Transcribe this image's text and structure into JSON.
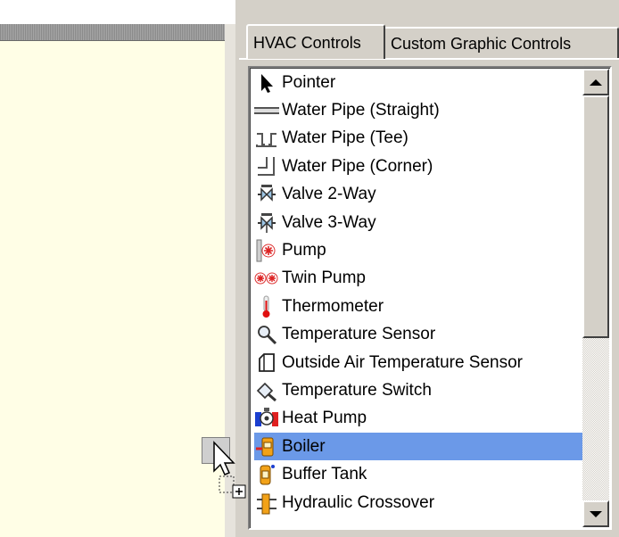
{
  "tabs": [
    {
      "label": "HVAC Controls",
      "active": true
    },
    {
      "label": "Custom Graphic Controls",
      "active": false
    }
  ],
  "list": {
    "selected_index": 13,
    "items": [
      {
        "label": "Pointer",
        "icon": "pointer-icon"
      },
      {
        "label": "Water Pipe (Straight)",
        "icon": "pipe-straight-icon"
      },
      {
        "label": "Water Pipe (Tee)",
        "icon": "pipe-tee-icon"
      },
      {
        "label": "Water Pipe (Corner)",
        "icon": "pipe-corner-icon"
      },
      {
        "label": "Valve 2-Way",
        "icon": "valve-2way-icon"
      },
      {
        "label": "Valve 3-Way",
        "icon": "valve-3way-icon"
      },
      {
        "label": "Pump",
        "icon": "pump-icon"
      },
      {
        "label": "Twin Pump",
        "icon": "twin-pump-icon"
      },
      {
        "label": "Thermometer",
        "icon": "thermometer-icon"
      },
      {
        "label": "Temperature Sensor",
        "icon": "temperature-sensor-icon"
      },
      {
        "label": "Outside Air Temperature Sensor",
        "icon": "outside-air-sensor-icon"
      },
      {
        "label": "Temperature Switch",
        "icon": "temperature-switch-icon"
      },
      {
        "label": "Heat Pump",
        "icon": "heat-pump-icon"
      },
      {
        "label": "Boiler",
        "icon": "boiler-icon"
      },
      {
        "label": "Buffer Tank",
        "icon": "buffer-tank-icon"
      },
      {
        "label": "Hydraulic Crossover",
        "icon": "hydraulic-crossover-icon"
      }
    ]
  },
  "colors": {
    "selection": "#6b99e8",
    "canvas_background": "#fffee6",
    "panel_background": "#d4d0c8"
  }
}
